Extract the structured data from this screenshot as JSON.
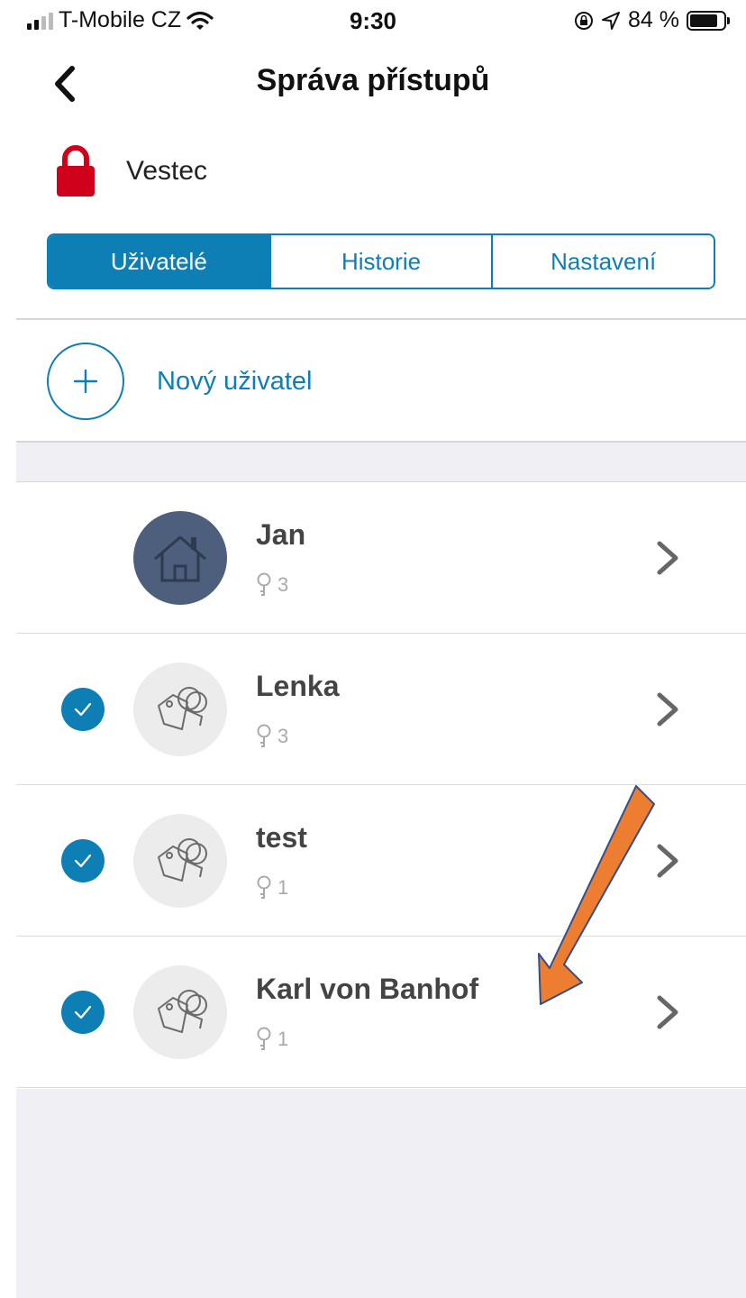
{
  "status_bar": {
    "carrier": "T-Mobile CZ",
    "time": "9:30",
    "battery": "84 %",
    "battery_level": 0.84,
    "icons": [
      "signal-icon",
      "wifi-icon",
      "orientation-lock-icon",
      "location-icon",
      "battery-icon"
    ]
  },
  "nav": {
    "title": "Správa přístupů",
    "back_icon": "chevron-left-icon"
  },
  "lock": {
    "name": "Vestec",
    "icon": "padlock-icon",
    "icon_color": "#d0021b"
  },
  "tabs": [
    {
      "label": "Uživatelé",
      "active": true
    },
    {
      "label": "Historie",
      "active": false
    },
    {
      "label": "Nastavení",
      "active": false
    }
  ],
  "new_user": {
    "label": "Nový uživatel",
    "icon": "plus-icon"
  },
  "users": [
    {
      "name": "Jan",
      "keys": "3",
      "avatar": "house-icon",
      "checked": false
    },
    {
      "name": "Lenka",
      "keys": "3",
      "avatar": "key-tags-icon",
      "checked": true
    },
    {
      "name": "test",
      "keys": "1",
      "avatar": "key-tags-icon",
      "checked": true
    },
    {
      "name": "Karl von Banhof",
      "keys": "1",
      "avatar": "key-tags-icon",
      "checked": true
    }
  ],
  "colors": {
    "accent": "#0e7fb5",
    "annotation_arrow": "#ed7d31",
    "annotation_arrow_outline": "#2f4f8f",
    "home_avatar_bg": "#4d5f7d"
  }
}
